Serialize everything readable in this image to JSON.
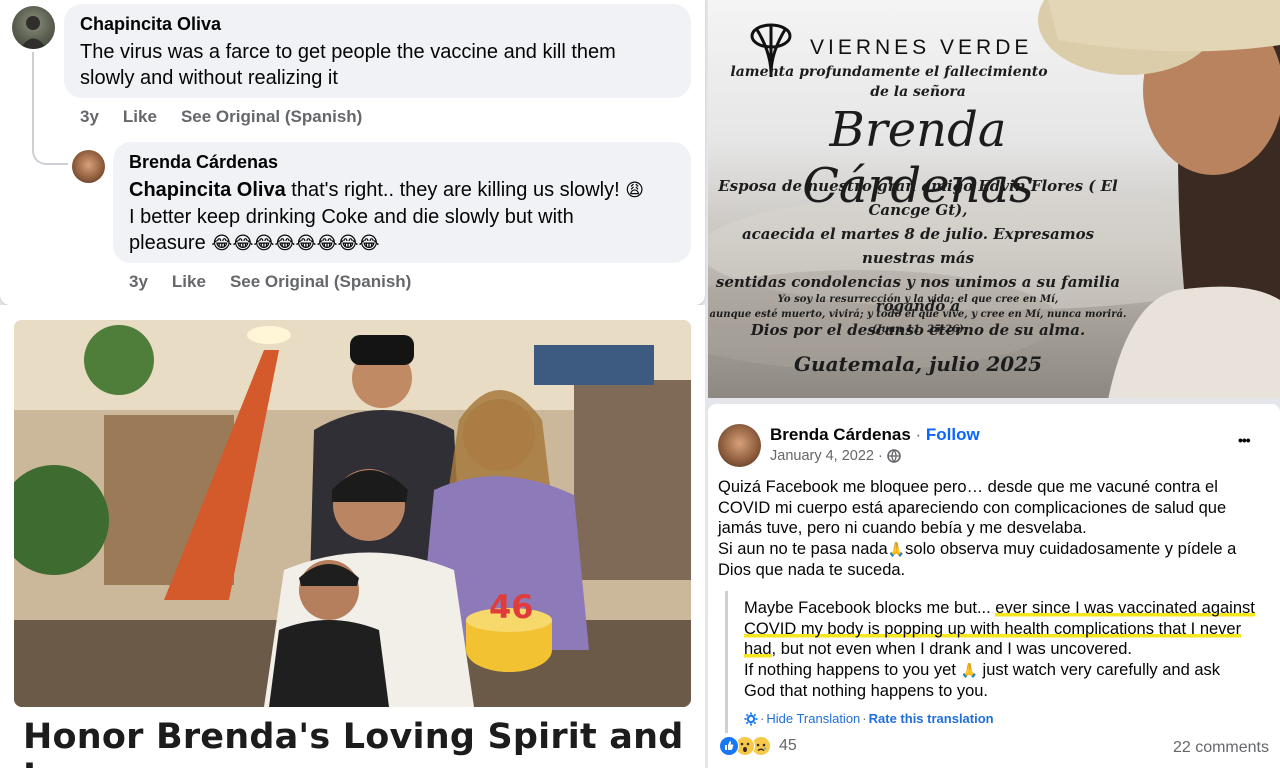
{
  "comments": [
    {
      "author": "Chapincita Oliva",
      "text": "The virus was a farce to get people the vaccine and kill them slowly and without realizing it",
      "time": "3y",
      "like": "Like",
      "see_original": "See Original (Spanish)"
    },
    {
      "author": "Brenda Cárdenas",
      "mention": "Chapincita Oliva",
      "text_line1": " that's right.. they are killing us slowly! ",
      "text_line2": "I better keep drinking Coke and die slowly but with",
      "text_line3": "pleasure ",
      "emoji_sad": "😩",
      "emoji_laugh": "😂😂😂😂😂😂😂😂",
      "time": "3y",
      "like": "Like",
      "see_original": "See Original (Spanish)"
    }
  ],
  "fundraiser": {
    "title": "Honor Brenda's Loving Spirit and Legacy",
    "cake_number": "46"
  },
  "obituary": {
    "org": "VIERNES VERDE",
    "line1": "lamenta  profundamente el fallecimiento",
    "line2": "de la señora",
    "name": "Brenda Cárdenas",
    "body": [
      "Esposa de nuestro gran amigo Edvin Flores ( El Cancge Gt),",
      "acaecida el martes 8 de julio. Expresamos nuestras más",
      "sentidas condolencias y nos unimos a su familia rogando a",
      "Dios por el descanso eterno de su alma."
    ],
    "verse": [
      "Yo soy la resurrección y la vida; el que cree en Mí,",
      "aunque esté muerto, vivirá; y todo el que vive,  y cree en Mí, nunca morirá.",
      "(Juan 11, 25-26)"
    ],
    "place_date": "Guatemala, julio 2025"
  },
  "post": {
    "author": "Brenda Cárdenas",
    "dot": " · ",
    "follow": "Follow",
    "date": "January 4, 2022 ·",
    "more": "•••",
    "spanish": [
      "Quizá Facebook me bloquee pero… desde que me vacuné contra el",
      "COVID mi cuerpo está apareciendo con complicaciones de salud que",
      "jamás tuve, pero ni cuando bebía y me desvelaba.",
      "Si aun no te pasa nada",
      "solo observa muy cuidadosamente y pídele a",
      "Dios que nada te suceda."
    ],
    "pray_emoji": "🙏",
    "translation": {
      "l1a": "Maybe Facebook blocks me but... ",
      "l1b": "ever since I was vaccinated against",
      "l2": "COVID my body is popping up with health complications that I never",
      "l3a": "had",
      "l3b": ", but not even when I drank and I was uncovered.",
      "l4a": "If nothing happens to you yet ",
      "l4b": " just watch very carefully and ask",
      "l5": "God that nothing happens to you."
    },
    "hide_translation": "Hide Translation",
    "rate_translation": "Rate this translation",
    "sep": " · ",
    "reaction_count": "45",
    "comments_count": "22 comments"
  },
  "colors": {
    "facebook_blue": "#0866ff",
    "link_blue": "#216fdb",
    "highlight": "#f5e61f",
    "muted": "#65676b"
  }
}
